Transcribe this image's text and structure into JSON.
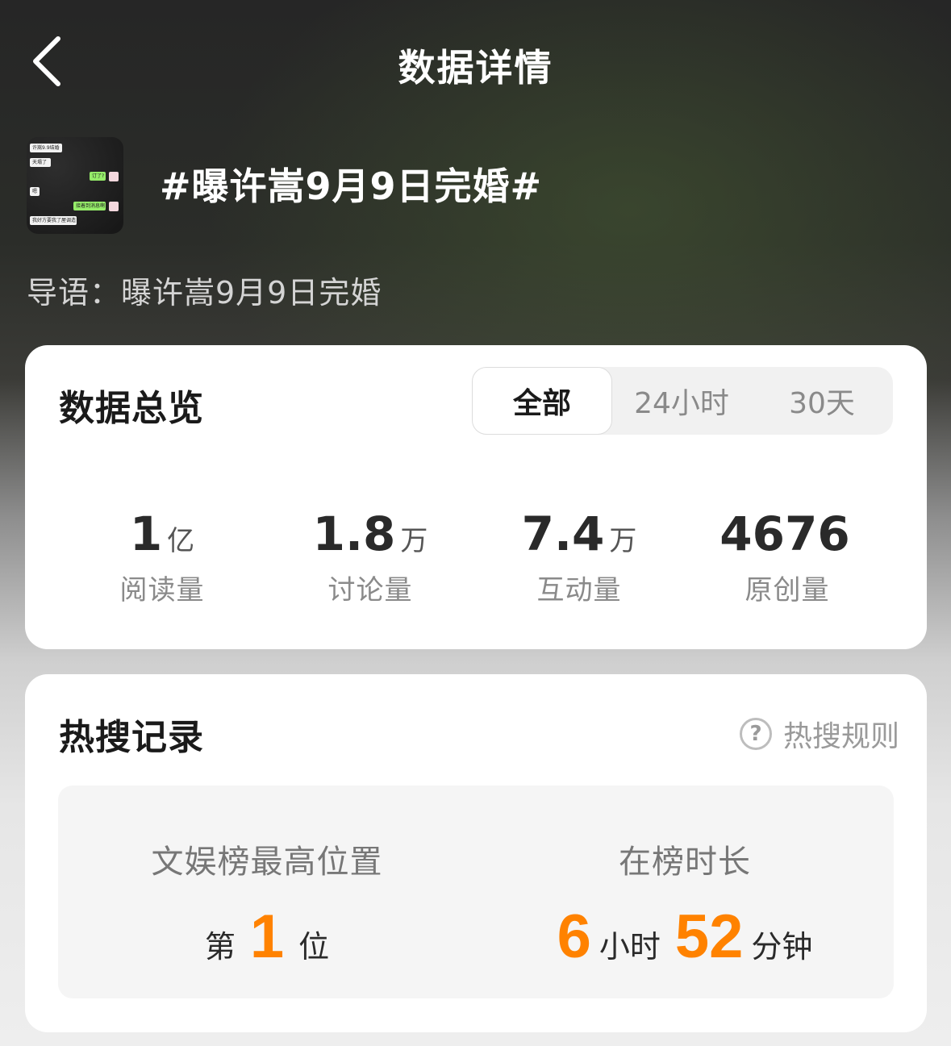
{
  "header": {
    "title": "数据详情"
  },
  "topic": {
    "title": "#曝许嵩9月9日完婚#",
    "intro": "导语：曝许嵩9月9日完婚",
    "thumbnail": {
      "bubbles": [
        "许嵩9.9结婚",
        "天塌了",
        "订了?",
        "嗯",
        "接着到消息啊",
        "我好方要我了屋调造"
      ]
    }
  },
  "overview": {
    "heading": "数据总览",
    "tabs": [
      {
        "label": "全部",
        "active": true
      },
      {
        "label": "24小时",
        "active": false
      },
      {
        "label": "30天",
        "active": false
      }
    ],
    "stats": [
      {
        "value": "1",
        "unit": "亿",
        "label": "阅读量"
      },
      {
        "value": "1.8",
        "unit": "万",
        "label": "讨论量"
      },
      {
        "value": "7.4",
        "unit": "万",
        "label": "互动量"
      },
      {
        "value": "4676",
        "unit": "",
        "label": "原创量"
      }
    ]
  },
  "hot": {
    "heading": "热搜记录",
    "rules_label": "热搜规则",
    "highest": {
      "label": "文娱榜最高位置",
      "prefix": "第",
      "value": "1",
      "suffix": "位"
    },
    "duration": {
      "label": "在榜时长",
      "hours": "6",
      "hours_unit": "小时",
      "minutes": "52",
      "minutes_unit": "分钟"
    }
  },
  "colors": {
    "accent": "#ff8200",
    "card": "#ffffff",
    "inner_box": "#f5f5f5"
  }
}
